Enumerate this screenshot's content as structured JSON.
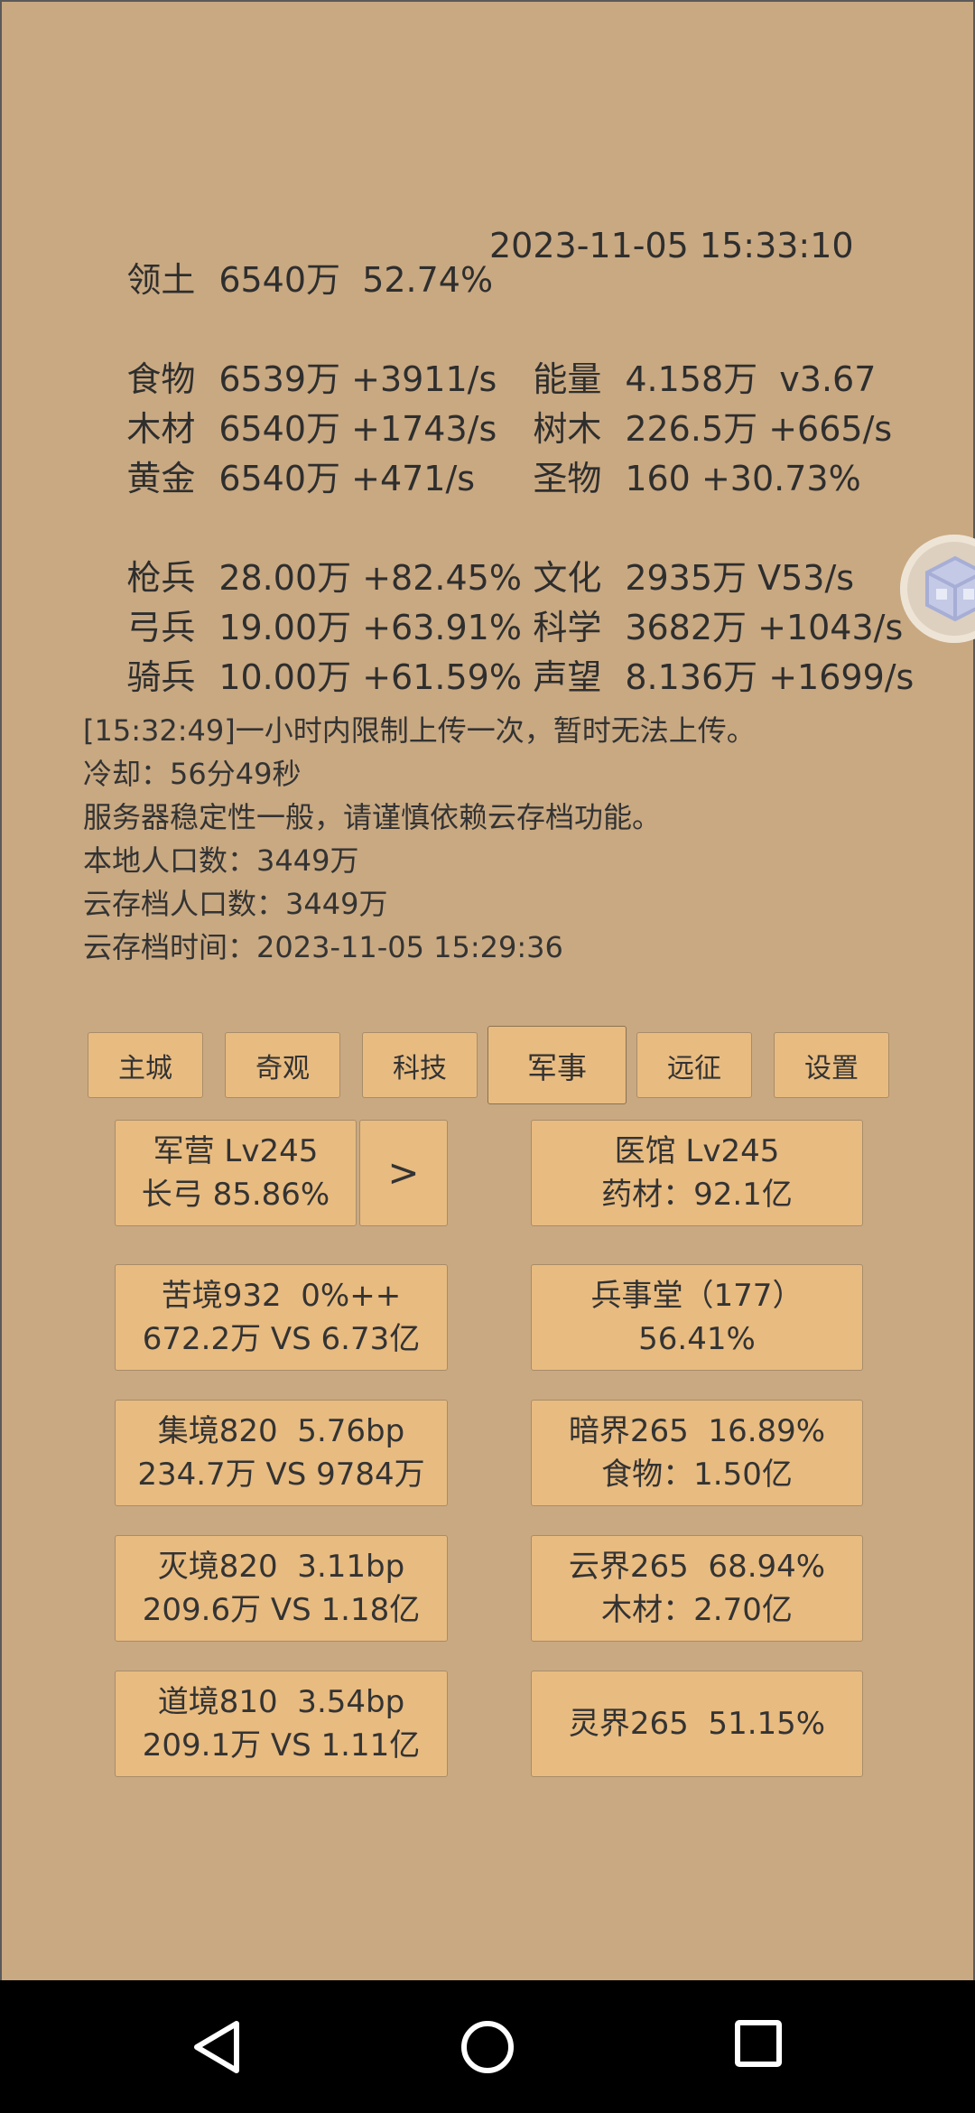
{
  "territory": {
    "label": "领土",
    "value": "6540万  52.74%",
    "datetime": "2023-11-05 15:33:10"
  },
  "resources": [
    {
      "label": "食物",
      "value": "6539万 +3911/s"
    },
    {
      "label": "木材",
      "value": "6540万 +1743/s"
    },
    {
      "label": "黄金",
      "value": "6540万 +471/s"
    },
    {
      "label": "能量",
      "value": "4.158万  v3.67"
    },
    {
      "label": "树木",
      "value": "226.5万 +665/s"
    },
    {
      "label": "圣物",
      "value": "160 +30.73%"
    }
  ],
  "military": [
    {
      "label": "枪兵",
      "value": "28.00万 +82.45%"
    },
    {
      "label": "弓兵",
      "value": "19.00万 +63.91%"
    },
    {
      "label": "骑兵",
      "value": "10.00万 +61.59%"
    },
    {
      "label": "文化",
      "value": "2935万 V53/s"
    },
    {
      "label": "科学",
      "value": "3682万 +1043/s"
    },
    {
      "label": "声望",
      "value": "8.136万 +1699/s"
    }
  ],
  "messages": [
    "[15:32:49]一小时内限制上传一次，暂时无法上传。",
    "冷却：56分49秒",
    "服务器稳定性一般，请谨慎依赖云存档功能。",
    "本地人口数：3449万",
    "云存档人口数：3449万",
    "云存档时间：2023-11-05 15:29:36"
  ],
  "tabs": [
    "主城",
    "奇观",
    "科技",
    "军事",
    "远征",
    "设置"
  ],
  "active_tab": "军事",
  "cards": {
    "barracks": {
      "line1": "军营 Lv245",
      "line2": "长弓 85.86%"
    },
    "arrow_label": ">",
    "hospital": {
      "line1": "医馆 Lv245",
      "line2": "药材：92.1亿"
    },
    "kujing": {
      "line1": "苦境932  0%++",
      "line2": "672.2万 VS 6.73亿"
    },
    "bingshitang": {
      "line1": "兵事堂（177）",
      "line2": "56.41%"
    },
    "jijing": {
      "line1": "集境820  5.76bp",
      "line2": "234.7万 VS 9784万"
    },
    "anjie": {
      "line1": "暗界265  16.89%",
      "line2": "食物：1.50亿"
    },
    "miejing": {
      "line1": "灭境820  3.11bp",
      "line2": "209.6万 VS 1.18亿"
    },
    "yunjie": {
      "line1": "云界265  68.94%",
      "line2": "木材：2.70亿"
    },
    "daojing": {
      "line1": "道境810  3.54bp",
      "line2": "209.1万 VS 1.11亿"
    },
    "lingjie": {
      "line1": "灵界265  51.15%"
    }
  },
  "colors": {
    "background": "#C9A982",
    "button": "#E8BB80",
    "text": "#2e2e2e",
    "navbar": "#000000"
  },
  "icons": {
    "floating": "cube-icon",
    "nav_back": "back-triangle-icon",
    "nav_home": "home-circle-icon",
    "nav_recents": "recents-square-icon"
  }
}
